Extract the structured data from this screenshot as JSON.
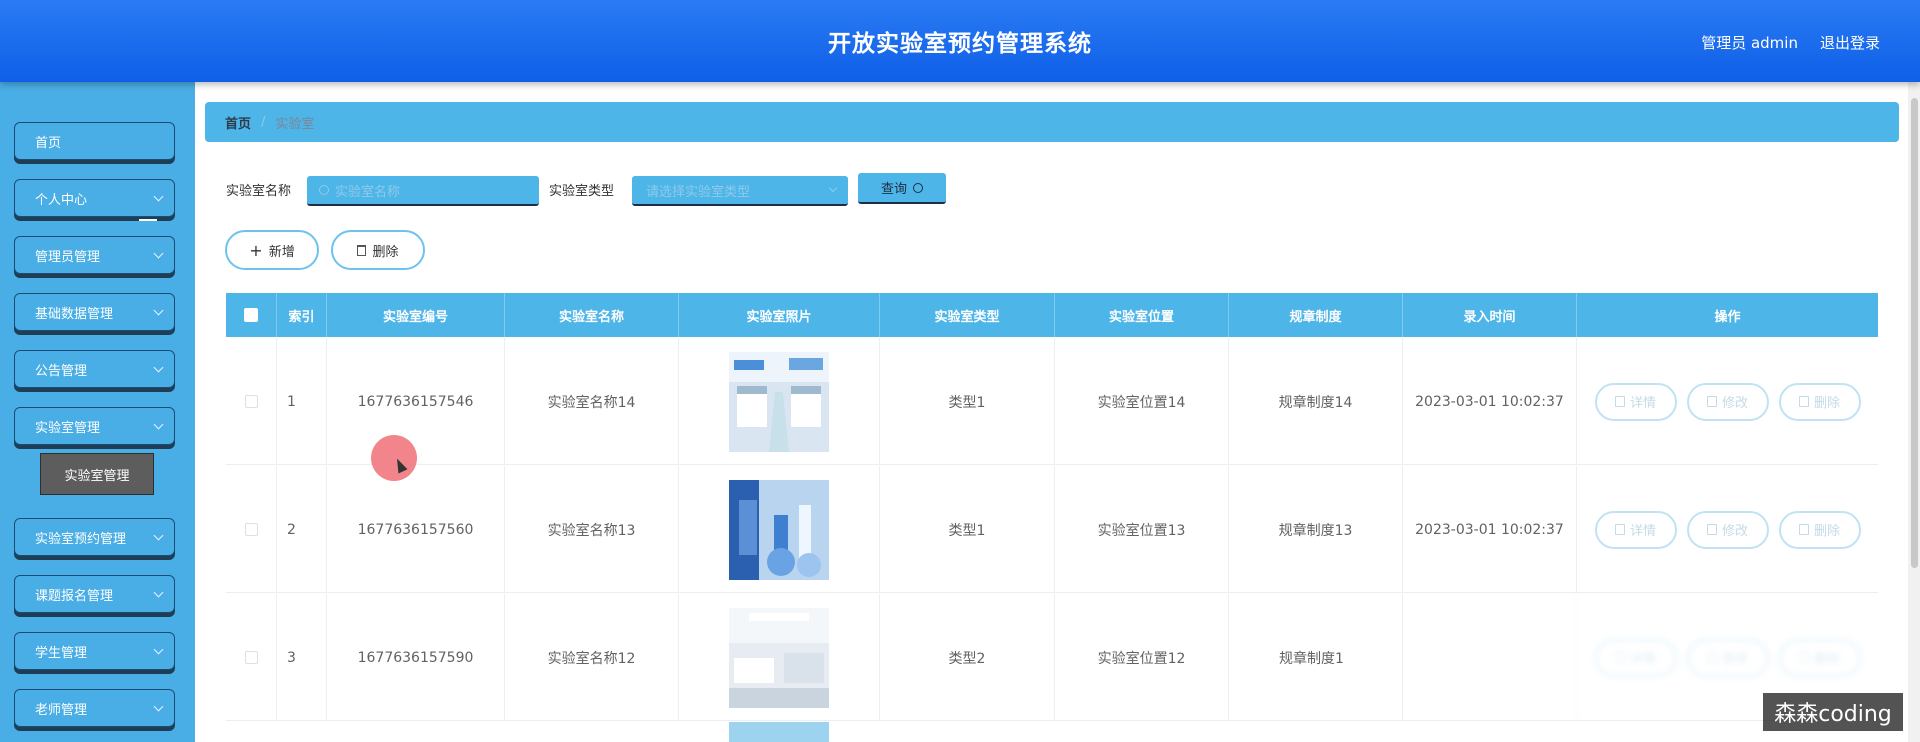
{
  "header": {
    "title": "开放实验室预约管理系统",
    "user_label": "管理员 admin",
    "logout_label": "退出登录"
  },
  "sidebar": {
    "items": [
      {
        "label": "首页"
      },
      {
        "label": "个人中心"
      },
      {
        "label": "管理员管理"
      },
      {
        "label": "基础数据管理"
      },
      {
        "label": "公告管理"
      },
      {
        "label": "实验室管理"
      },
      {
        "label": "实验室预约管理"
      },
      {
        "label": "课题报名管理"
      },
      {
        "label": "学生管理"
      },
      {
        "label": "老师管理"
      }
    ],
    "submenu": {
      "label": "实验室管理"
    }
  },
  "breadcrumb": {
    "home": "首页",
    "separator": "/",
    "current": "实验室"
  },
  "search": {
    "name_label": "实验室名称",
    "name_placeholder": "实验室名称",
    "type_label": "实验室类型",
    "type_placeholder": "请选择实验室类型",
    "query_label": "查询"
  },
  "actions": {
    "add_label": "新增",
    "delete_label": "删除"
  },
  "table": {
    "columns": [
      "索引",
      "实验室编号",
      "实验室名称",
      "实验室照片",
      "实验室类型",
      "实验室位置",
      "规章制度",
      "录入时间",
      "操作"
    ],
    "rows": [
      {
        "index": "1",
        "code": "1677636157546",
        "name": "实验室名称14",
        "type": "类型1",
        "location": "实验室位置14",
        "rules": "规章制度14",
        "time": "2023-03-01 10:02:37"
      },
      {
        "index": "2",
        "code": "1677636157560",
        "name": "实验室名称13",
        "type": "类型1",
        "location": "实验室位置13",
        "rules": "规章制度13",
        "time": "2023-03-01 10:02:37"
      },
      {
        "index": "3",
        "code": "1677636157590",
        "name": "实验室名称12",
        "type": "类型2",
        "location": "实验室位置12",
        "rules": "规章制度1",
        "time": ""
      }
    ],
    "op_labels": {
      "detail": "详情",
      "edit": "修改",
      "delete": "删除"
    }
  },
  "watermark": "森森coding",
  "colors": {
    "topbar": "#1a6ef0",
    "sidebar": "#4aaee6",
    "table_header": "#4db5e8",
    "accent_border": "#6ec2ec"
  }
}
